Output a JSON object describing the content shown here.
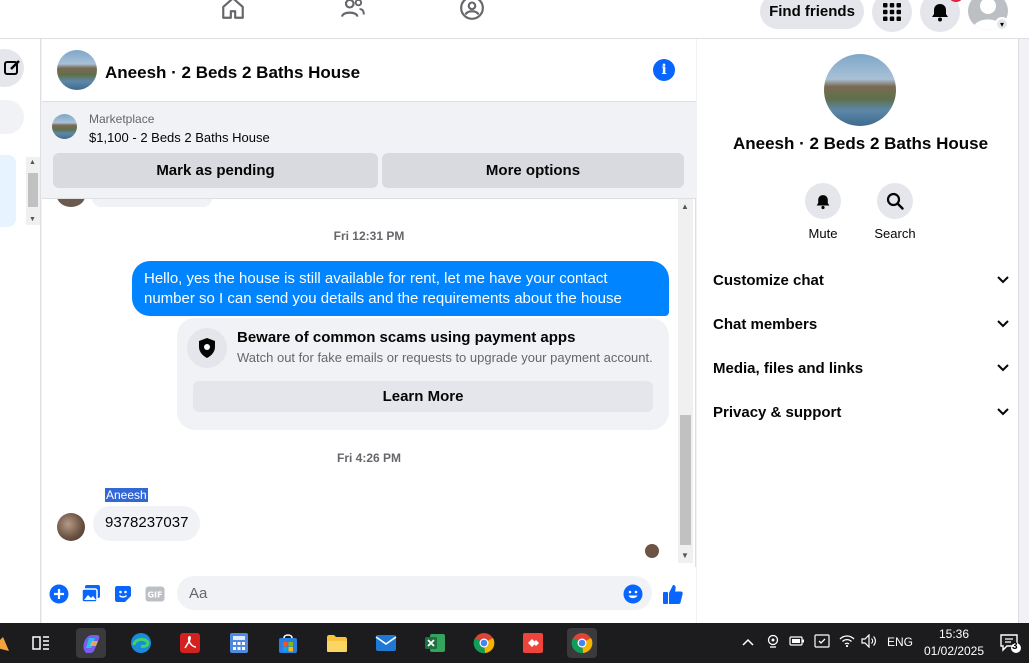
{
  "topbar": {
    "find_friends_label": "Find friends",
    "nav_icons": [
      "home-icon",
      "friends-icon",
      "groups-icon"
    ],
    "apps_icon": "grid-icon",
    "notifications_icon": "bell-icon"
  },
  "chat": {
    "title": "Aneesh · 2 Beds 2 Baths House",
    "marketplace_label": "Marketplace",
    "marketplace_listing": "$1,100 - 2 Beds 2 Baths House",
    "mark_pending_label": "Mark as pending",
    "more_options_label": "More options",
    "timestamp_1": "Fri 12:31 PM",
    "outgoing_message": "Hello, yes the house is still available for rent, let me have your contact number so I can send you details and the requirements about the house",
    "scam_title": "Beware of common scams using payment apps",
    "scam_subtitle": "Watch out for fake emails or requests to upgrade your payment account.",
    "learn_more_label": "Learn More",
    "timestamp_2": "Fri 4:26 PM",
    "sender_name": "Aneesh",
    "incoming_message": "9378237037",
    "composer_placeholder": "Aa"
  },
  "details": {
    "name": "Aneesh · 2 Beds 2 Baths House",
    "mute_label": "Mute",
    "search_label": "Search",
    "sections": [
      "Customize chat",
      "Chat members",
      "Media, files and links",
      "Privacy & support"
    ]
  },
  "taskbar": {
    "language": "ENG",
    "time": "15:36",
    "date": "01/02/2025",
    "notification_count": "3"
  },
  "colors": {
    "accent": "#0084ff",
    "brand_blue": "#0866ff",
    "badge_red": "#e41e3f"
  }
}
